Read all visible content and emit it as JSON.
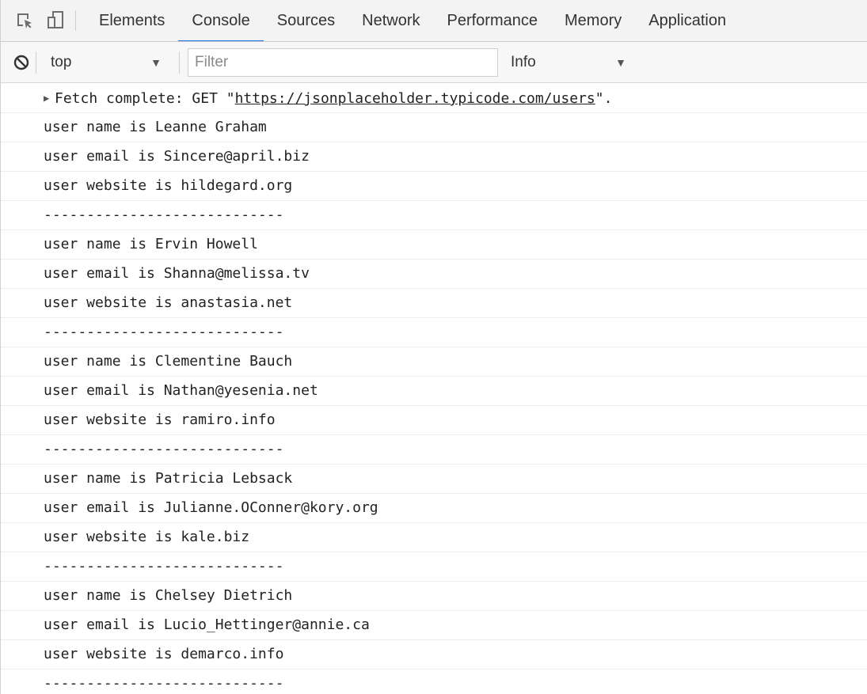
{
  "tabbar": {
    "icons": [
      "inspect-element-icon",
      "device-toolbar-icon"
    ],
    "tabs": [
      {
        "label": "Elements",
        "active": false
      },
      {
        "label": "Console",
        "active": true
      },
      {
        "label": "Sources",
        "active": false
      },
      {
        "label": "Network",
        "active": false
      },
      {
        "label": "Performance",
        "active": false
      },
      {
        "label": "Memory",
        "active": false
      },
      {
        "label": "Application",
        "active": false
      }
    ]
  },
  "toolbar": {
    "clear_icon": "clear-console-icon",
    "context": "top",
    "filter_placeholder": "Filter",
    "filter_value": "",
    "level": "Info",
    "caret": "▼"
  },
  "console": {
    "fetch": {
      "arrow": "▶",
      "prefix": "Fetch complete: GET \"",
      "url": "https://jsonplaceholder.typicode.com/users",
      "suffix": "\"."
    },
    "lines": [
      "user name is Leanne Graham",
      "user email is Sincere@april.biz",
      "user website is hildegard.org",
      "----------------------------",
      "user name is Ervin Howell",
      "user email is Shanna@melissa.tv",
      "user website is anastasia.net",
      "----------------------------",
      "user name is Clementine Bauch",
      "user email is Nathan@yesenia.net",
      "user website is ramiro.info",
      "----------------------------",
      "user name is Patricia Lebsack",
      "user email is Julianne.OConner@kory.org",
      "user website is kale.biz",
      "----------------------------",
      "user name is Chelsey Dietrich",
      "user email is Lucio_Hettinger@annie.ca",
      "user website is demarco.info",
      "----------------------------"
    ]
  },
  "colors": {
    "active_tab_underline": "#1a73e8",
    "toolbar_background": "#f3f3f3"
  }
}
